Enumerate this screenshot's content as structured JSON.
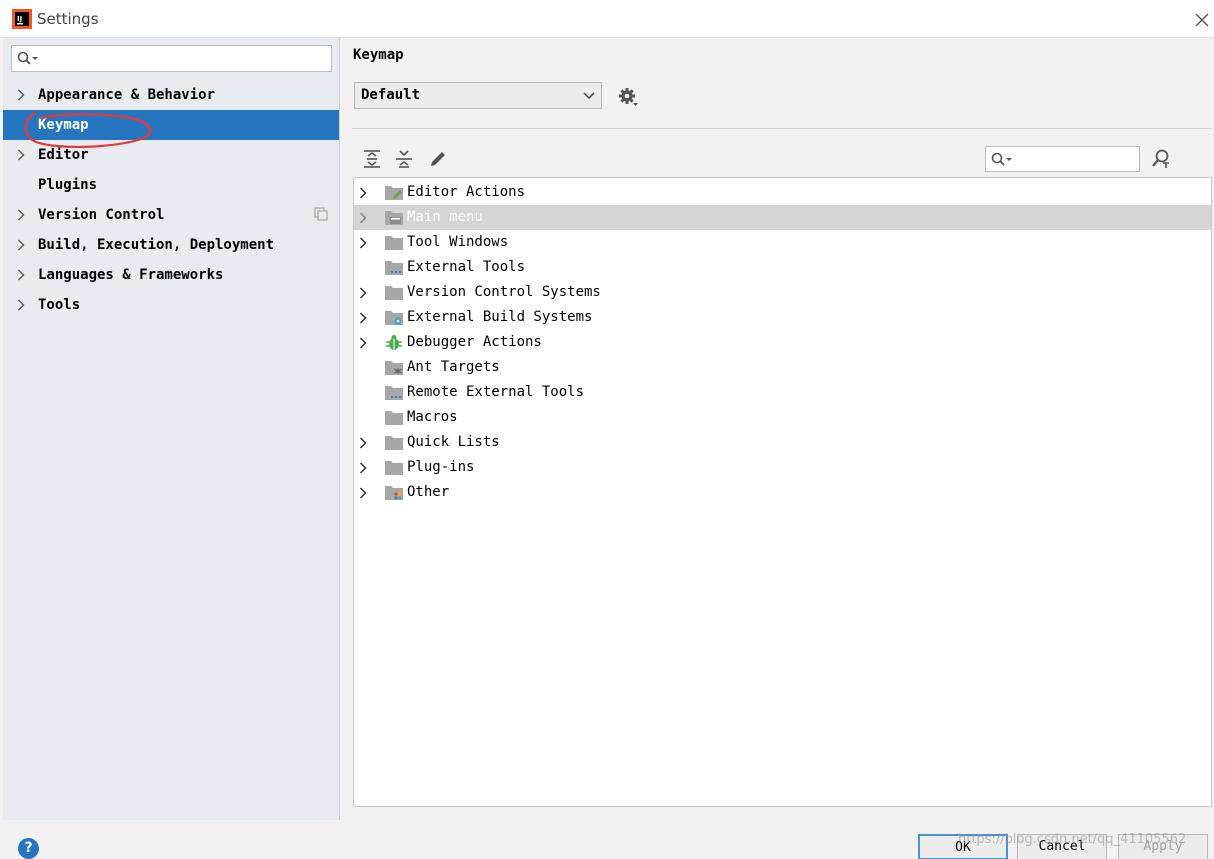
{
  "window": {
    "title": "Settings"
  },
  "sidebar": {
    "search_placeholder": "",
    "items": [
      {
        "label": "Appearance & Behavior",
        "expandable": true
      },
      {
        "label": "Keymap",
        "expandable": false,
        "selected": true
      },
      {
        "label": "Editor",
        "expandable": true
      },
      {
        "label": "Plugins",
        "expandable": false
      },
      {
        "label": "Version Control",
        "expandable": true
      },
      {
        "label": "Build, Execution, Deployment",
        "expandable": true
      },
      {
        "label": "Languages & Frameworks",
        "expandable": true
      },
      {
        "label": "Tools",
        "expandable": true
      }
    ]
  },
  "main": {
    "title": "Keymap",
    "keymap_select": {
      "value": "Default"
    },
    "filter_placeholder": "",
    "tree": [
      {
        "label": "Editor Actions",
        "icon": "folder-edit-icon",
        "expandable": true
      },
      {
        "label": "Main menu",
        "icon": "folder-menu-icon",
        "expandable": true,
        "highlighted": true
      },
      {
        "label": "Tool Windows",
        "icon": "folder-icon",
        "expandable": true
      },
      {
        "label": "External Tools",
        "icon": "folder-tools-icon",
        "expandable": false
      },
      {
        "label": "Version Control Systems",
        "icon": "folder-icon",
        "expandable": true
      },
      {
        "label": "External Build Systems",
        "icon": "folder-gear-icon",
        "expandable": true
      },
      {
        "label": "Debugger Actions",
        "icon": "bug-icon",
        "expandable": true
      },
      {
        "label": "Ant Targets",
        "icon": "folder-ant-icon",
        "expandable": false
      },
      {
        "label": "Remote External Tools",
        "icon": "folder-tools-icon",
        "expandable": false
      },
      {
        "label": "Macros",
        "icon": "folder-icon",
        "expandable": false
      },
      {
        "label": "Quick Lists",
        "icon": "folder-icon",
        "expandable": true
      },
      {
        "label": "Plug-ins",
        "icon": "folder-icon",
        "expandable": true
      },
      {
        "label": "Other",
        "icon": "folder-other-icon",
        "expandable": true
      }
    ]
  },
  "footer": {
    "help": "?",
    "ok": "OK",
    "cancel": "Cancel",
    "apply": "Apply",
    "watermark": "https://blog.csdn.net/qq_41105562"
  },
  "colors": {
    "selection": "#2675bf",
    "annotation": "#e53935",
    "highlight_row": "#d5d5d5"
  }
}
